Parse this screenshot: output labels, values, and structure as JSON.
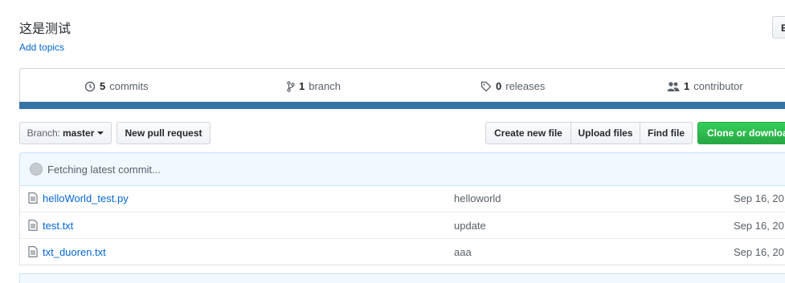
{
  "repo": {
    "description": "这是测试",
    "add_topics": "Add topics",
    "edit_label": "E"
  },
  "summary": {
    "commits_count": "5",
    "commits_label": "commits",
    "branches_count": "1",
    "branches_label": "branch",
    "releases_count": "0",
    "releases_label": "releases",
    "contributors_count": "1",
    "contributors_label": "contributor",
    "language_color": "#3572A5"
  },
  "toolbar": {
    "branch_prefix": "Branch:",
    "branch_name": "master",
    "new_pull_request": "New pull request",
    "create_new_file": "Create new file",
    "upload_files": "Upload files",
    "find_file": "Find file",
    "clone_download": "Clone or download"
  },
  "commit_tease": {
    "text": "Fetching latest commit..."
  },
  "files": [
    {
      "name": "helloWorld_test.py",
      "message": "helloworld",
      "age": "Sep 16, 20"
    },
    {
      "name": "test.txt",
      "message": "update",
      "age": "Sep 16, 20"
    },
    {
      "name": "txt_duoren.txt",
      "message": "aaa",
      "age": "Sep 16, 20"
    }
  ],
  "icons": {
    "commits": "history-icon",
    "branch": "git-branch-icon",
    "releases": "tag-icon",
    "contributors": "people-icon",
    "file": "file-text-icon"
  }
}
